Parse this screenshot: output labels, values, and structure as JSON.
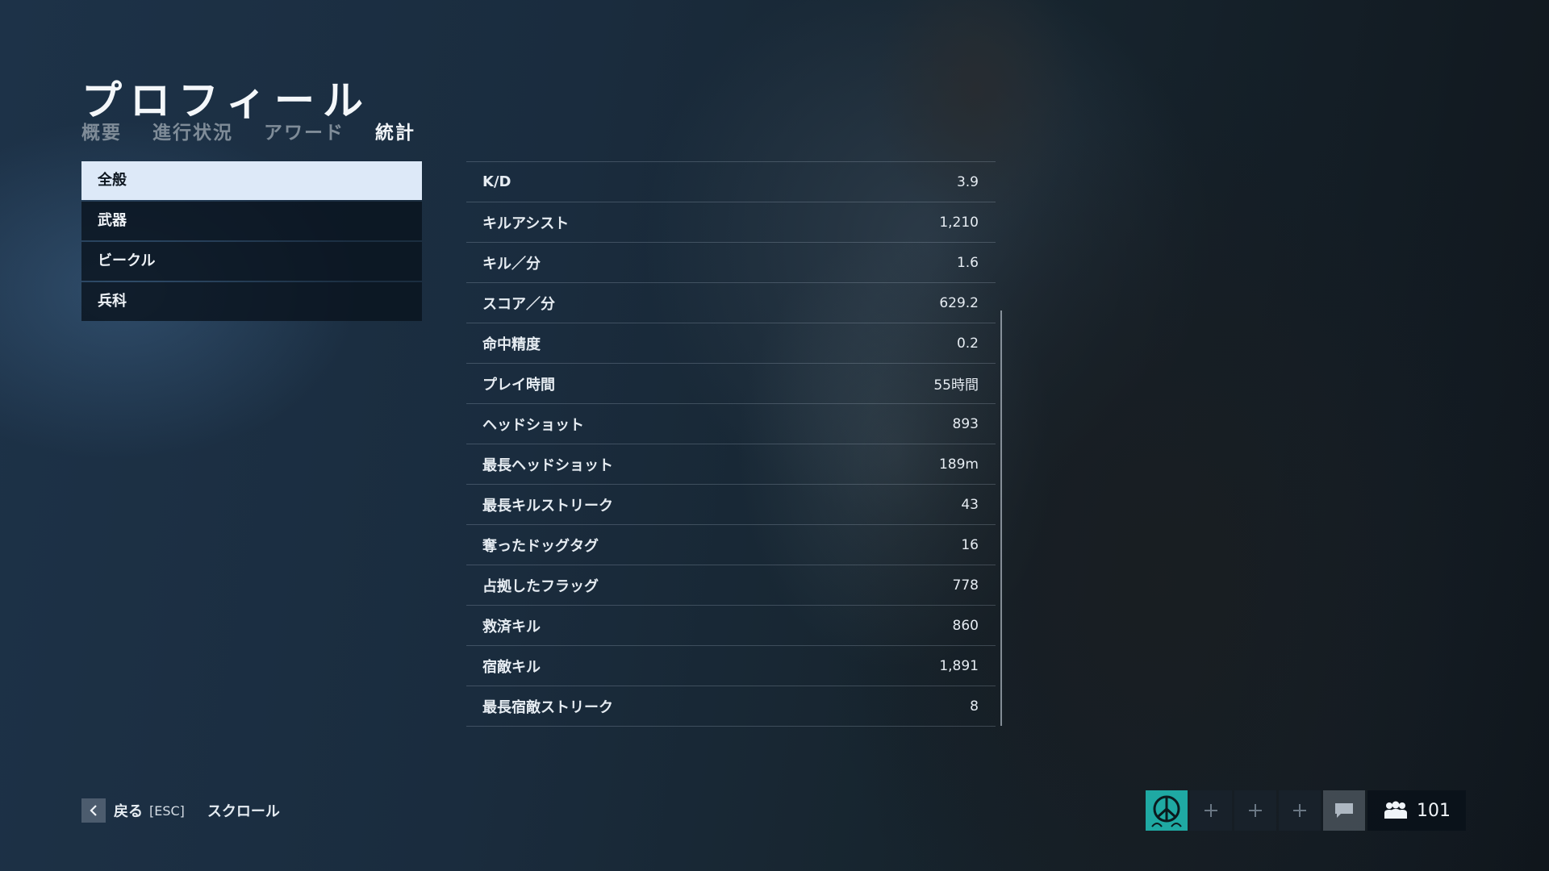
{
  "header": {
    "title": "プロフィール",
    "tabs": [
      {
        "label": "概要"
      },
      {
        "label": "進行状況"
      },
      {
        "label": "アワード"
      },
      {
        "label": "統計"
      }
    ],
    "active_tab": "統計"
  },
  "sidebar": {
    "items": [
      {
        "label": "全般"
      },
      {
        "label": "武器"
      },
      {
        "label": "ビークル"
      },
      {
        "label": "兵科"
      }
    ],
    "active_item": "全般"
  },
  "stats": {
    "rows": [
      {
        "label": "K/D",
        "value": "3.9"
      },
      {
        "label": "キルアシスト",
        "value": "1,210"
      },
      {
        "label": "キル／分",
        "value": "1.6"
      },
      {
        "label": "スコア／分",
        "value": "629.2"
      },
      {
        "label": "命中精度",
        "value": "0.2"
      },
      {
        "label": "プレイ時間",
        "value": "55時間"
      },
      {
        "label": "ヘッドショット",
        "value": "893"
      },
      {
        "label": "最長ヘッドショット",
        "value": "189m"
      },
      {
        "label": "最長キルストリーク",
        "value": "43"
      },
      {
        "label": "奪ったドッグタグ",
        "value": "16"
      },
      {
        "label": "占拠したフラッグ",
        "value": "778"
      },
      {
        "label": "救済キル",
        "value": "860"
      },
      {
        "label": "宿敵キル",
        "value": "1,891"
      },
      {
        "label": "最長宿敵ストリーク",
        "value": "8"
      }
    ]
  },
  "footer": {
    "back_label": "戻る",
    "esc_label": "[ESC]",
    "scroll_label": "スクロール"
  },
  "squad": {
    "avatar_icon": "peace-symbol-icon",
    "empty_slot_icon": "plus-icon",
    "chat_icon": "chat-bubble-icon",
    "friends_icon": "friends-group-icon",
    "friends_count": "101"
  },
  "colors": {
    "active_menu_bg": "#dde9f8",
    "avatar_bg": "#1fa9a3"
  }
}
